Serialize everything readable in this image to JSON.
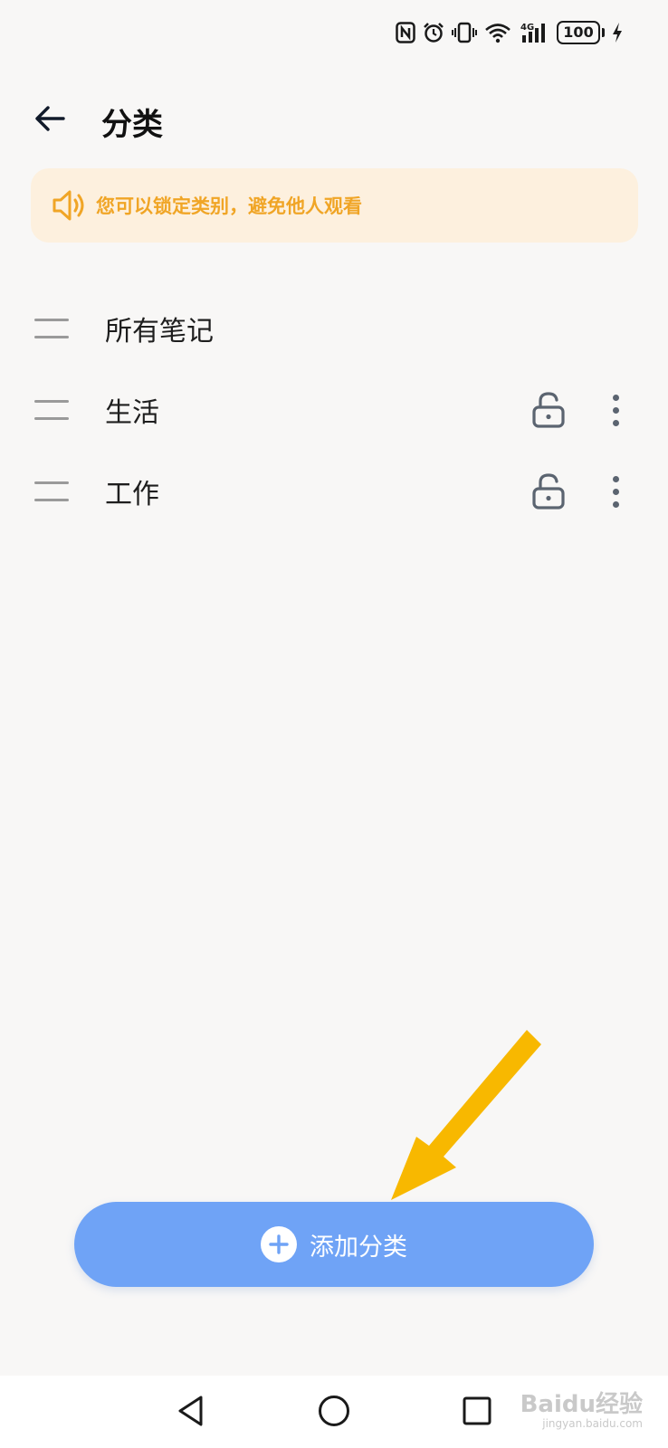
{
  "status_bar": {
    "network": "4G",
    "battery": "100",
    "icons": [
      "nfc-icon",
      "alarm-icon",
      "vibrate-icon",
      "wifi-icon",
      "signal-icon",
      "battery-icon",
      "charging-icon"
    ]
  },
  "header": {
    "back_icon": "back-arrow-icon",
    "title": "分类"
  },
  "notice": {
    "icon": "speaker-icon",
    "text": "您可以锁定类别，避免他人观看",
    "color": "#f0a526",
    "background": "#fdf0de"
  },
  "categories": [
    {
      "name": "所有笔记",
      "lockable": false
    },
    {
      "name": "生活",
      "lockable": true,
      "locked": false
    },
    {
      "name": "工作",
      "lockable": true,
      "locked": false
    }
  ],
  "add_button": {
    "icon": "plus-icon",
    "label": "添加分类",
    "color": "#6fa3f6"
  },
  "annotation": {
    "icon": "arrow-pointer-icon",
    "color": "#f8b800"
  },
  "nav_bar": {
    "icons": [
      "back-triangle-icon",
      "home-circle-icon",
      "recents-square-icon"
    ]
  },
  "watermark": {
    "text": "Baidu经验",
    "subtext": "jingyan.baidu.com"
  }
}
